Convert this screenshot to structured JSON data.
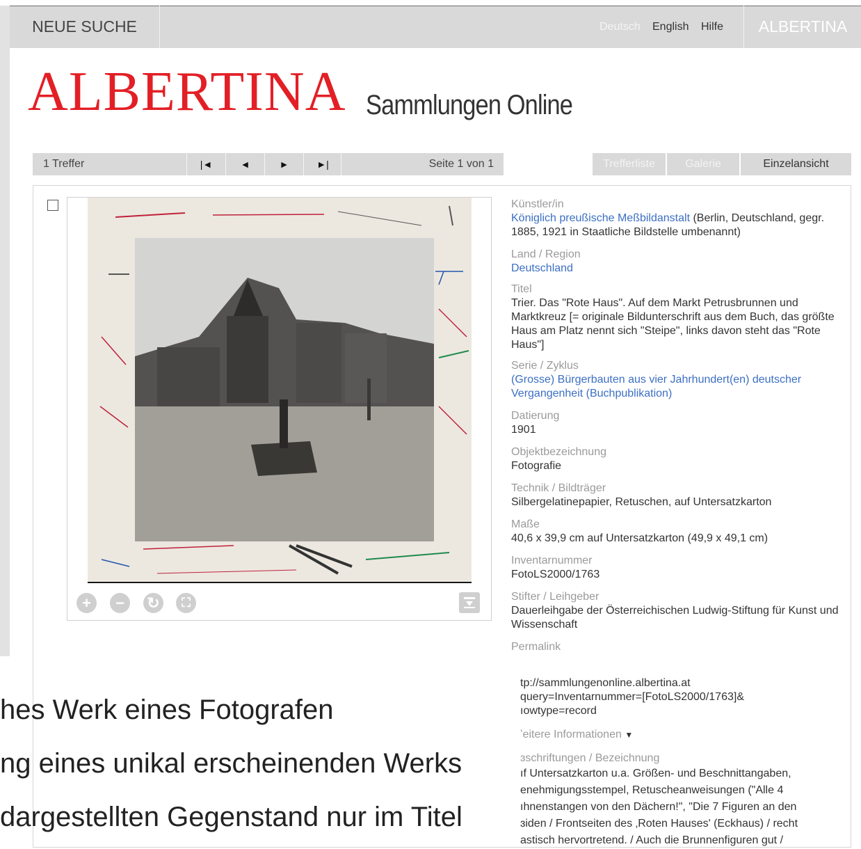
{
  "topbar": {
    "neue_suche": "NEUE SUCHE",
    "lang_de": "Deutsch",
    "lang_en": "English",
    "hilfe": "Hilfe",
    "albertina": "ALBERTINA"
  },
  "header": {
    "logo": "ALBERTINA",
    "subtitle": "Sammlungen Online"
  },
  "nav": {
    "treffer": "1 Treffer",
    "first": "|◄",
    "prev": "◄",
    "next": "►",
    "last": "►|",
    "seite": "Seite 1 von 1",
    "tabs": [
      "Trefferliste",
      "Galerie",
      "Einzelansicht"
    ]
  },
  "viewer": {
    "tools": [
      "zoom-in-icon",
      "zoom-out-icon",
      "rotate-icon",
      "fullscreen-icon",
      "download-icon"
    ],
    "zoom_in": "+",
    "zoom_out": "−",
    "rotate": "↻",
    "fullscreen": "⛶"
  },
  "record": {
    "kuenstler_label": "Künstler/in",
    "kuenstler_link": "Königlich preußische Meßbildanstalt",
    "kuenstler_rest": " (Berlin, Deutschland, gegr. 1885, 1921 in Staatliche Bildstelle umbenannt)",
    "land_label": "Land / Region",
    "land_value": "Deutschland",
    "titel_label": "Titel",
    "titel_value": "Trier. Das \"Rote Haus\". Auf dem Markt Petrusbrunnen und Marktkreuz [= originale Bildunterschrift aus dem Buch, das größte Haus am Platz nennt sich \"Steipe\", links davon steht das \"Rote Haus\"]",
    "serie_label": "Serie / Zyklus",
    "serie_value": "(Grosse) Bürgerbauten aus vier Jahrhundert(en) deutscher Vergangenheit (Buchpublikation)",
    "datierung_label": "Datierung",
    "datierung_value": "1901",
    "objekt_label": "Objektbezeichnung",
    "objekt_value": "Fotografie",
    "technik_label": "Technik / Bildträger",
    "technik_value": "Silbergelatinepapier, Retuschen, auf Untersatzkarton",
    "masse_label": "Maße",
    "masse_value": "40,6 x 39,9 cm auf Untersatzkarton (49,9 x 49,1 cm)",
    "inventar_label": "Inventarnummer",
    "inventar_value": "FotoLS2000/1763",
    "stifter_label": "Stifter / Leihgeber",
    "stifter_value": "Dauerleihgabe der Österreichischen Ludwig-Stiftung für Kunst und Wissenschaft",
    "permalink_label": "Permalink",
    "permalink_1": "tp://sammlungenonline.albertina.at",
    "permalink_2": "query=Inventarnummer=[FotoLS2000/1763]&",
    "permalink_3": "ıowtype=record",
    "weitere": "ʼeitere Informationen",
    "beschriftung_label": "ɜschriftungen / Bezeichnung",
    "beschriftung_1": "ıf Untersatzkarton u.a. Größen- und Beschnittangaben,",
    "beschriftung_2": "enehmigungsstempel, Retuscheanweisungen (\"Alle 4",
    "beschriftung_3": "ıhnenstangen von den Dächern!\", \"Die 7 Figuren an den",
    "beschriftung_4": "ɜiden / Frontseiten des ‚Roten Hauses' (Eckhaus) / recht",
    "beschriftung_5": "astisch hervortretend. / Auch die Brunnenfiguren gut /"
  },
  "caption": {
    "line1": "hes Werk eines Fotografen",
    "line2": "ng eines unikal erscheinenden Werks",
    "line3": " dargestellten Gegenstand nur im Titel"
  },
  "colors": {
    "accent": "#e31f26",
    "link": "#3c6fc4",
    "bar": "#d9d9d9"
  }
}
